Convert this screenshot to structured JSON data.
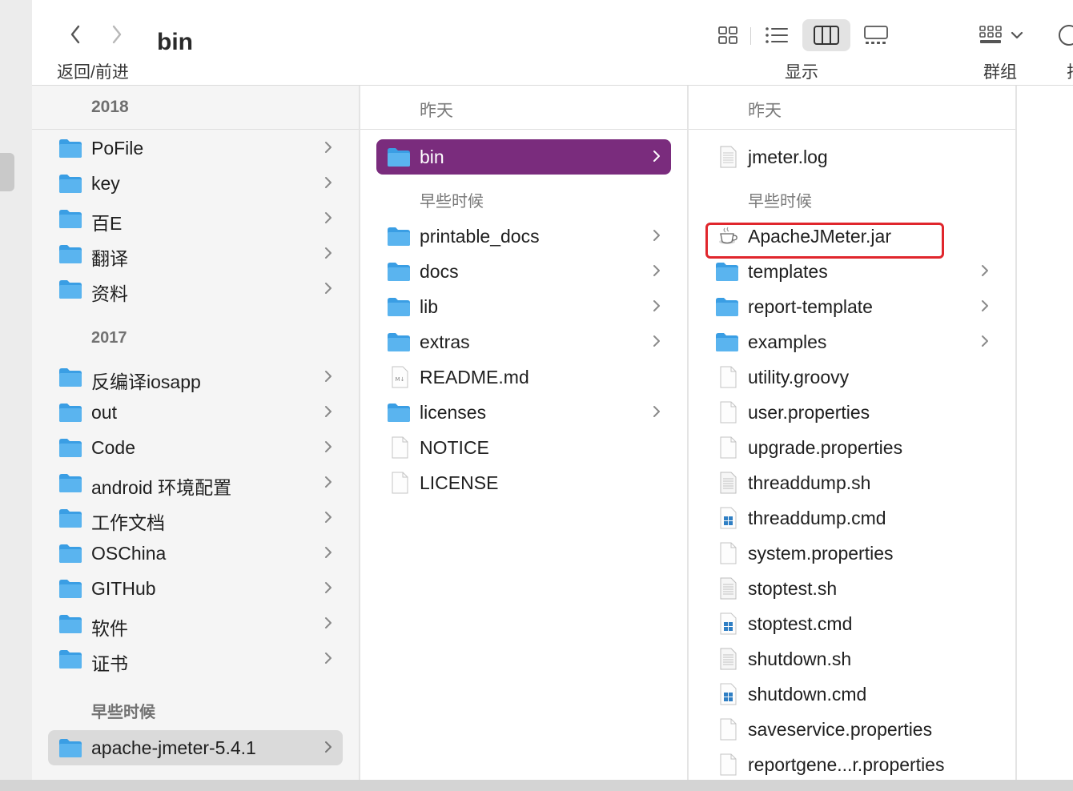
{
  "toolbar": {
    "title": "bin",
    "nav_label": "返回/前进",
    "view_label": "显示",
    "group_label": "群组",
    "cut_label": "排"
  },
  "columns": {
    "col1": {
      "header": "2018",
      "group_2018": [
        "PoFile",
        "key",
        "百E",
        "翻译",
        "资料"
      ],
      "section_2017": "2017",
      "group_2017": [
        "反编译iosapp",
        "out",
        "Code",
        "android 环境配置",
        "工作文档",
        "OSChina",
        "GITHub",
        "软件",
        "证书"
      ],
      "section_earlier": "早些时候",
      "selected": "apache-jmeter-5.4.1"
    },
    "col2": {
      "header": "昨天",
      "selected": "bin",
      "section_earlier": "早些时候",
      "items": [
        {
          "name": "printable_docs",
          "type": "folder"
        },
        {
          "name": "docs",
          "type": "folder"
        },
        {
          "name": "lib",
          "type": "folder"
        },
        {
          "name": "extras",
          "type": "folder"
        },
        {
          "name": "README.md",
          "type": "md"
        },
        {
          "name": "licenses",
          "type": "folder"
        },
        {
          "name": "NOTICE",
          "type": "doc"
        },
        {
          "name": "LICENSE",
          "type": "doc"
        }
      ]
    },
    "col3": {
      "header": "昨天",
      "first": "jmeter.log",
      "section_earlier": "早些时候",
      "items": [
        {
          "name": "ApacheJMeter.jar",
          "type": "jar"
        },
        {
          "name": "templates",
          "type": "folder"
        },
        {
          "name": "report-template",
          "type": "folder"
        },
        {
          "name": "examples",
          "type": "folder"
        },
        {
          "name": "utility.groovy",
          "type": "doc"
        },
        {
          "name": "user.properties",
          "type": "doc"
        },
        {
          "name": "upgrade.properties",
          "type": "doc"
        },
        {
          "name": "threaddump.sh",
          "type": "script"
        },
        {
          "name": "threaddump.cmd",
          "type": "cmd"
        },
        {
          "name": "system.properties",
          "type": "doc"
        },
        {
          "name": "stoptest.sh",
          "type": "script"
        },
        {
          "name": "stoptest.cmd",
          "type": "cmd"
        },
        {
          "name": "shutdown.sh",
          "type": "script"
        },
        {
          "name": "shutdown.cmd",
          "type": "cmd"
        },
        {
          "name": "saveservice.properties",
          "type": "doc"
        },
        {
          "name": "reportgene...r.properties",
          "type": "doc"
        }
      ]
    }
  },
  "colors": {
    "selection_active": "#7a2c7d",
    "selection_inactive": "#dadada",
    "folder_blue": "#5ab4ef",
    "highlight_red": "#e0262c"
  }
}
